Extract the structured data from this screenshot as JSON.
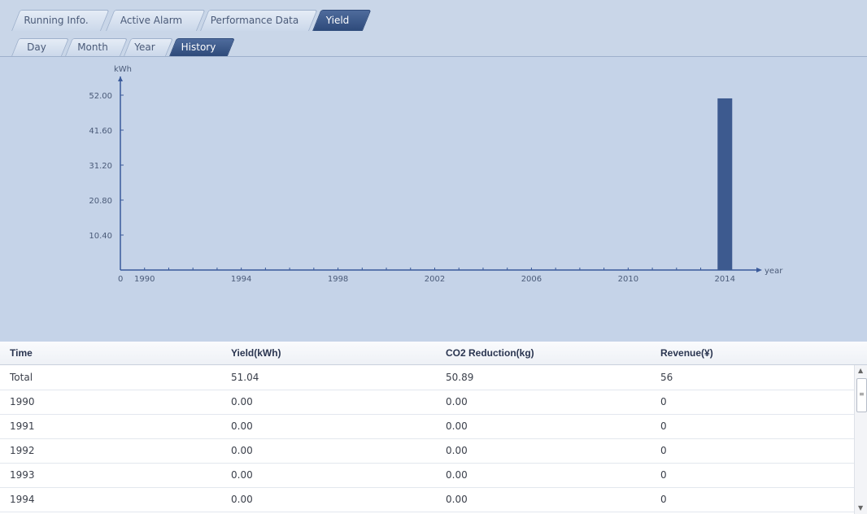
{
  "tabs": {
    "primary": [
      {
        "label": "Running Info.",
        "active": false
      },
      {
        "label": "Active Alarm",
        "active": false
      },
      {
        "label": "Performance Data",
        "active": false
      },
      {
        "label": "Yield",
        "active": true
      }
    ],
    "secondary": [
      {
        "label": "Day",
        "active": false
      },
      {
        "label": "Month",
        "active": false
      },
      {
        "label": "Year",
        "active": false
      },
      {
        "label": "History",
        "active": true
      }
    ]
  },
  "chart_data": {
    "type": "bar",
    "ylabel": "kWh",
    "xlabel": "year",
    "x_ticks": [
      "1990",
      "1994",
      "1998",
      "2002",
      "2006",
      "2010",
      "2014"
    ],
    "origin_label": "0",
    "y_ticks": [
      "10.40",
      "20.80",
      "31.20",
      "41.60",
      "52.00"
    ],
    "ylim": [
      0,
      52
    ],
    "xlim": [
      1989,
      2015
    ],
    "series": [
      {
        "x": [
          2014
        ],
        "values": [
          51.04
        ]
      }
    ],
    "bar_color": "#3d5a8f",
    "axis_color": "#3a5a9a"
  },
  "table": {
    "columns": [
      "Time",
      "Yield(kWh)",
      "CO2 Reduction(kg)",
      "Revenue(¥)"
    ],
    "rows": [
      [
        "Total",
        "51.04",
        "50.89",
        "56"
      ],
      [
        "1990",
        "0.00",
        "0.00",
        "0"
      ],
      [
        "1991",
        "0.00",
        "0.00",
        "0"
      ],
      [
        "1992",
        "0.00",
        "0.00",
        "0"
      ],
      [
        "1993",
        "0.00",
        "0.00",
        "0"
      ],
      [
        "1994",
        "0.00",
        "0.00",
        "0"
      ]
    ]
  },
  "scrollbar": {
    "up": "▲",
    "down": "▼",
    "grip": "≡"
  }
}
